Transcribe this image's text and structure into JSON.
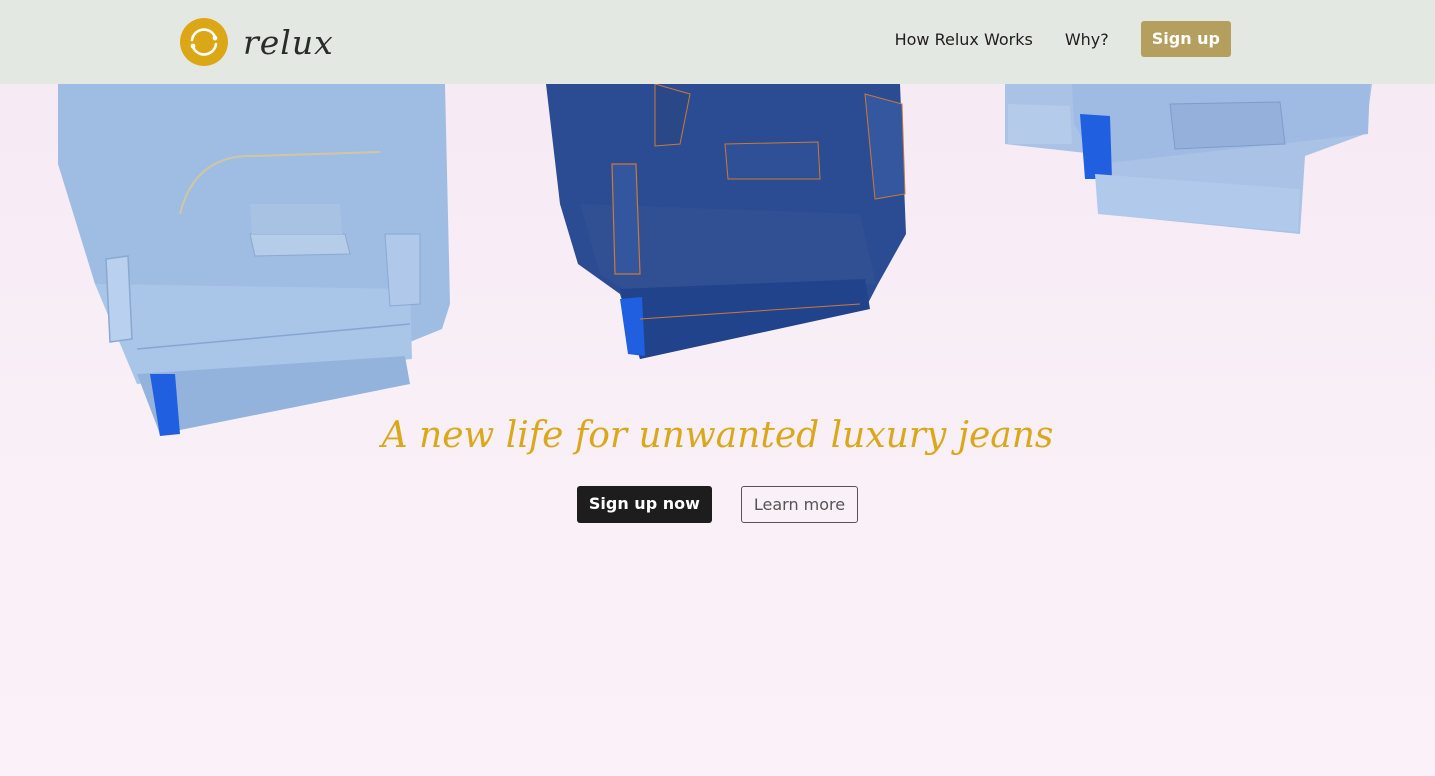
{
  "brand": {
    "name": "relux",
    "logo_icon": "circular-arrows-logo-icon",
    "color": "#dca716"
  },
  "nav": {
    "links": [
      {
        "label": "How Relux Works"
      },
      {
        "label": "Why?"
      }
    ],
    "signup_label": "Sign up",
    "signup_color": "#b59f5f"
  },
  "hero": {
    "image": "folded-jeans-hanging-on-wall",
    "headline": "A new life for unwanted luxury jeans",
    "headline_color": "#dba81c",
    "primary_cta": "Sign up now",
    "secondary_cta": "Learn more"
  }
}
